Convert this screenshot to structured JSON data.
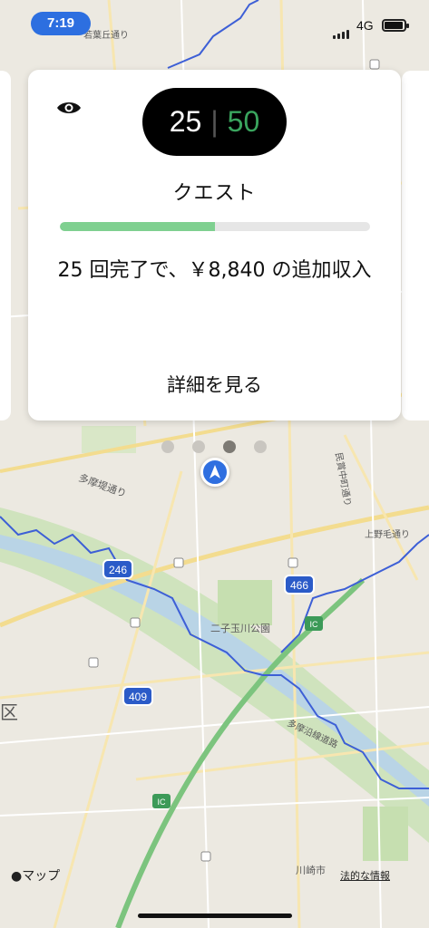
{
  "status_bar": {
    "time": "7:19",
    "network": "4G"
  },
  "quest_card": {
    "current": "25",
    "separator": "|",
    "goal": "50",
    "title": "クエスト",
    "progress_fraction": 0.5,
    "description": "25 回完了で、￥8,840 の追加収入",
    "details_label": "詳細を見る"
  },
  "pager": {
    "count": 4,
    "active_index": 2
  },
  "map": {
    "labels": {
      "tamatsutsumi": "多摩堤通り",
      "futako_park": "二子玉川公園",
      "kaminoge": "上野毛通り",
      "minka": "民賞中町通り",
      "tama_enkaku": "多摩沿線道路",
      "wakabadai": "若葉丘通り",
      "ku": "区",
      "ic1": "IC",
      "ic2": "IC",
      "route_246": "246",
      "route_466": "466",
      "route_409": "409",
      "kawasaki": "川崎市"
    }
  },
  "footer": {
    "maps_label": "マップ",
    "legal_label": "法的な情報"
  },
  "colors": {
    "accent_green": "#3aa55e",
    "progress_green": "#7fd090",
    "nav_blue": "#2f6fe0"
  }
}
